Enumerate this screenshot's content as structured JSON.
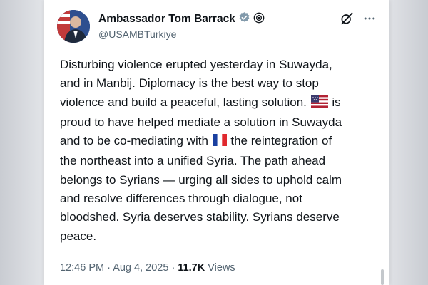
{
  "author": {
    "name": "Ambassador Tom Barrack",
    "handle": "@USAMBTurkiye"
  },
  "tweet": {
    "line_1": "Disturbing violence erupted yesterday in Suwayda,",
    "line_2": "and in Manbij. Diplomacy is the best way to stop",
    "line_3": "violence and build a peaceful, lasting solution.",
    "line_4_after_flag": "is",
    "line_5": "proud to have helped mediate a solution in Suwayda",
    "line_6_before_flag": "and to be co-mediating with",
    "line_6_after_flag": "the reintegration of",
    "line_7": "the northeast into a unified Syria. The path ahead",
    "line_8": "belongs to Syrians — urging all sides to uphold calm",
    "line_9": "and resolve differences through dialogue, not",
    "line_10": "bloodshed. Syria deserves stability. Syrians deserve",
    "line_11": "peace."
  },
  "meta": {
    "time": "12:46 PM",
    "separator": "·",
    "date": "Aug 4, 2025",
    "views_count": "11.7K",
    "views_label": "Views"
  },
  "colors": {
    "verified_badge": "#829aab",
    "text": "#0f1419",
    "secondary": "#536471"
  },
  "icons": {
    "verified": "verified-badge-icon",
    "affiliation": "affiliation-icon",
    "grok": "grok-icon",
    "more": "more-options-icon"
  }
}
